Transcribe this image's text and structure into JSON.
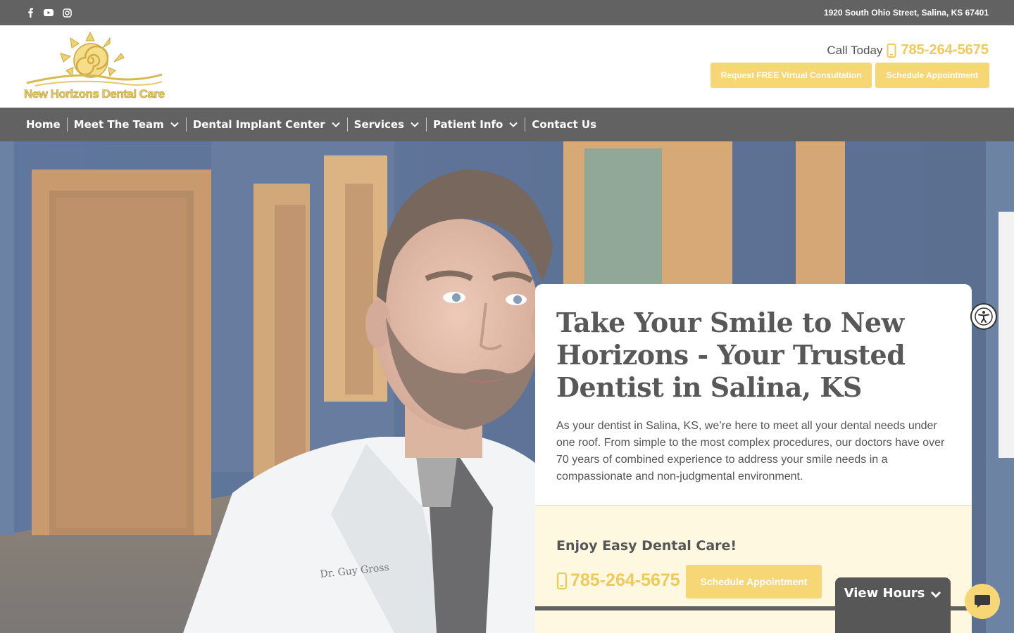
{
  "topbar": {
    "social_icons": [
      "facebook-icon",
      "youtube-icon",
      "instagram-icon"
    ],
    "address": "1920 South Ohio Street, Salina, KS 67401"
  },
  "header": {
    "logo_text": "New Horizons Dental Care",
    "call_label": "Call Today",
    "call_number": "785-264-5675",
    "btn_consult": "Request FREE Virtual Consultation",
    "btn_schedule": "Schedule Appointment"
  },
  "nav": {
    "items": [
      {
        "label": "Home",
        "dropdown": false
      },
      {
        "label": "Meet The Team",
        "dropdown": true
      },
      {
        "label": "Dental Implant Center",
        "dropdown": true
      },
      {
        "label": "Services",
        "dropdown": true
      },
      {
        "label": "Patient Info",
        "dropdown": true
      },
      {
        "label": "Contact Us",
        "dropdown": false
      }
    ]
  },
  "hero": {
    "coat_name": "Dr. Guy Gross",
    "title": "Take Your Smile to New Horizons - Your Trusted Dentist in Salina, KS",
    "text": "As your dentist in Salina, KS, we’re here to meet all your dental needs under one roof. From simple to the most complex procedures, our doctors have over 70 years of combined experience to address your smile needs in a compassionate and non-judgmental environment.",
    "enjoy": "Enjoy Easy Dental Care!",
    "phone": "785-264-5675",
    "schedule": "Schedule Appointment",
    "view_hours": "View Hours"
  },
  "colors": {
    "gold": "#f7d775",
    "gray_bar": "#626262",
    "cream": "#fdf8df"
  }
}
